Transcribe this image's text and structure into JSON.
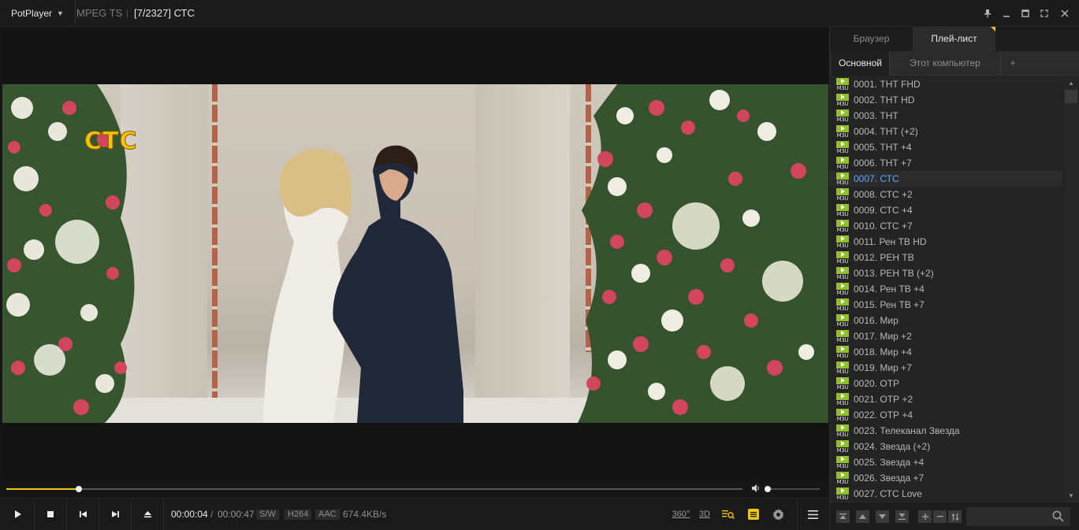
{
  "titlebar": {
    "app_name": "PotPlayer",
    "format": "MPEG TS",
    "title": "[7/2327] СТС"
  },
  "video": {
    "channel_logo": "СТС"
  },
  "seek": {
    "progress": 0.098,
    "volume": 0.0
  },
  "controls": {
    "time_current": "00:00:04",
    "time_sep": "/",
    "time_total": "00:00:47",
    "tag_sw": "S/W",
    "tag_video": "H264",
    "tag_audio": "AAC",
    "rate": "674.4KB/s",
    "label_360": "360°",
    "label_3d": "3D"
  },
  "panel": {
    "tab_browser": "Браузер",
    "tab_playlist": "Плей-лист",
    "subtab_main": "Основной",
    "subtab_computer": "Этот компьютер",
    "subtab_add": "+",
    "badge": "M3U",
    "items": [
      "0001. ТНТ FHD",
      "0002. ТНТ HD",
      "0003. ТНТ",
      "0004. ТНТ (+2)",
      "0005. ТНТ +4",
      "0006. ТНТ +7",
      "0007. СТС",
      "0008. СТС +2",
      "0009. СТС +4",
      "0010. СТС +7",
      "0011. Рен ТВ HD",
      "0012. РЕН ТВ",
      "0013. РЕН ТВ (+2)",
      "0014. Рен ТВ +4",
      "0015. Рен ТВ +7",
      "0016. Мир",
      "0017. Мир +2",
      "0018. Мир +4",
      "0019. Мир +7",
      "0020. ОТР",
      "0021. ОТР +2",
      "0022. ОТР +4",
      "0023. Телеканал Звезда",
      "0024. Звезда (+2)",
      "0025. Звезда +4",
      "0026. Звезда +7",
      "0027. СТС Love"
    ],
    "active_index": 6
  },
  "colors": {
    "accent": "#f0c419",
    "selected_text": "#5ea8ff",
    "badge_green": "#8fbf2a"
  }
}
